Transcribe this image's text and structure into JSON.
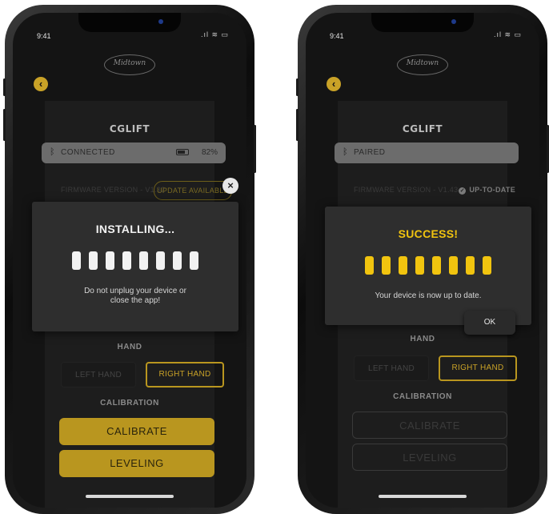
{
  "colors": {
    "gold": "#b9961f",
    "success_yellow": "#f1c40f",
    "modal_bg": "#2e2e2e",
    "screen_bg": "#141414"
  },
  "left_phone": {
    "status_time": "9:41",
    "logo_text": "Midtown",
    "device_title": "CGLIFT",
    "connection_label": "CONNECTED",
    "battery_percent": "82%",
    "firmware_label": "FIRMWARE VERSION - V1.32",
    "update_button_label": "UPDATE AVAILABLE",
    "hand_label": "HAND",
    "left_hand_label": "LEFT HAND",
    "right_hand_label": "RIGHT HAND",
    "calibration_label": "CALIBRATION",
    "calibrate_label": "CALIBRATE",
    "leveling_label": "LEVELING",
    "modal": {
      "title": "INSTALLING...",
      "message_line1": "Do not unplug your device or",
      "message_line2": "close the app!"
    }
  },
  "right_phone": {
    "status_time": "9:41",
    "logo_text": "Midtown",
    "device_title": "CGLIFT",
    "connection_label": "PAIRED",
    "firmware_label": "FIRMWARE VERSION - V1.43",
    "uptodate_label": "UP-TO-DATE",
    "hand_label": "HAND",
    "left_hand_label": "LEFT HAND",
    "right_hand_label": "RIGHT HAND",
    "calibration_label": "CALIBRATION",
    "calibrate_label": "CALIBRATE",
    "leveling_label": "LEVELING",
    "modal": {
      "title": "SUCCESS!",
      "message": "Your device is now up to date.",
      "ok_label": "OK"
    }
  }
}
